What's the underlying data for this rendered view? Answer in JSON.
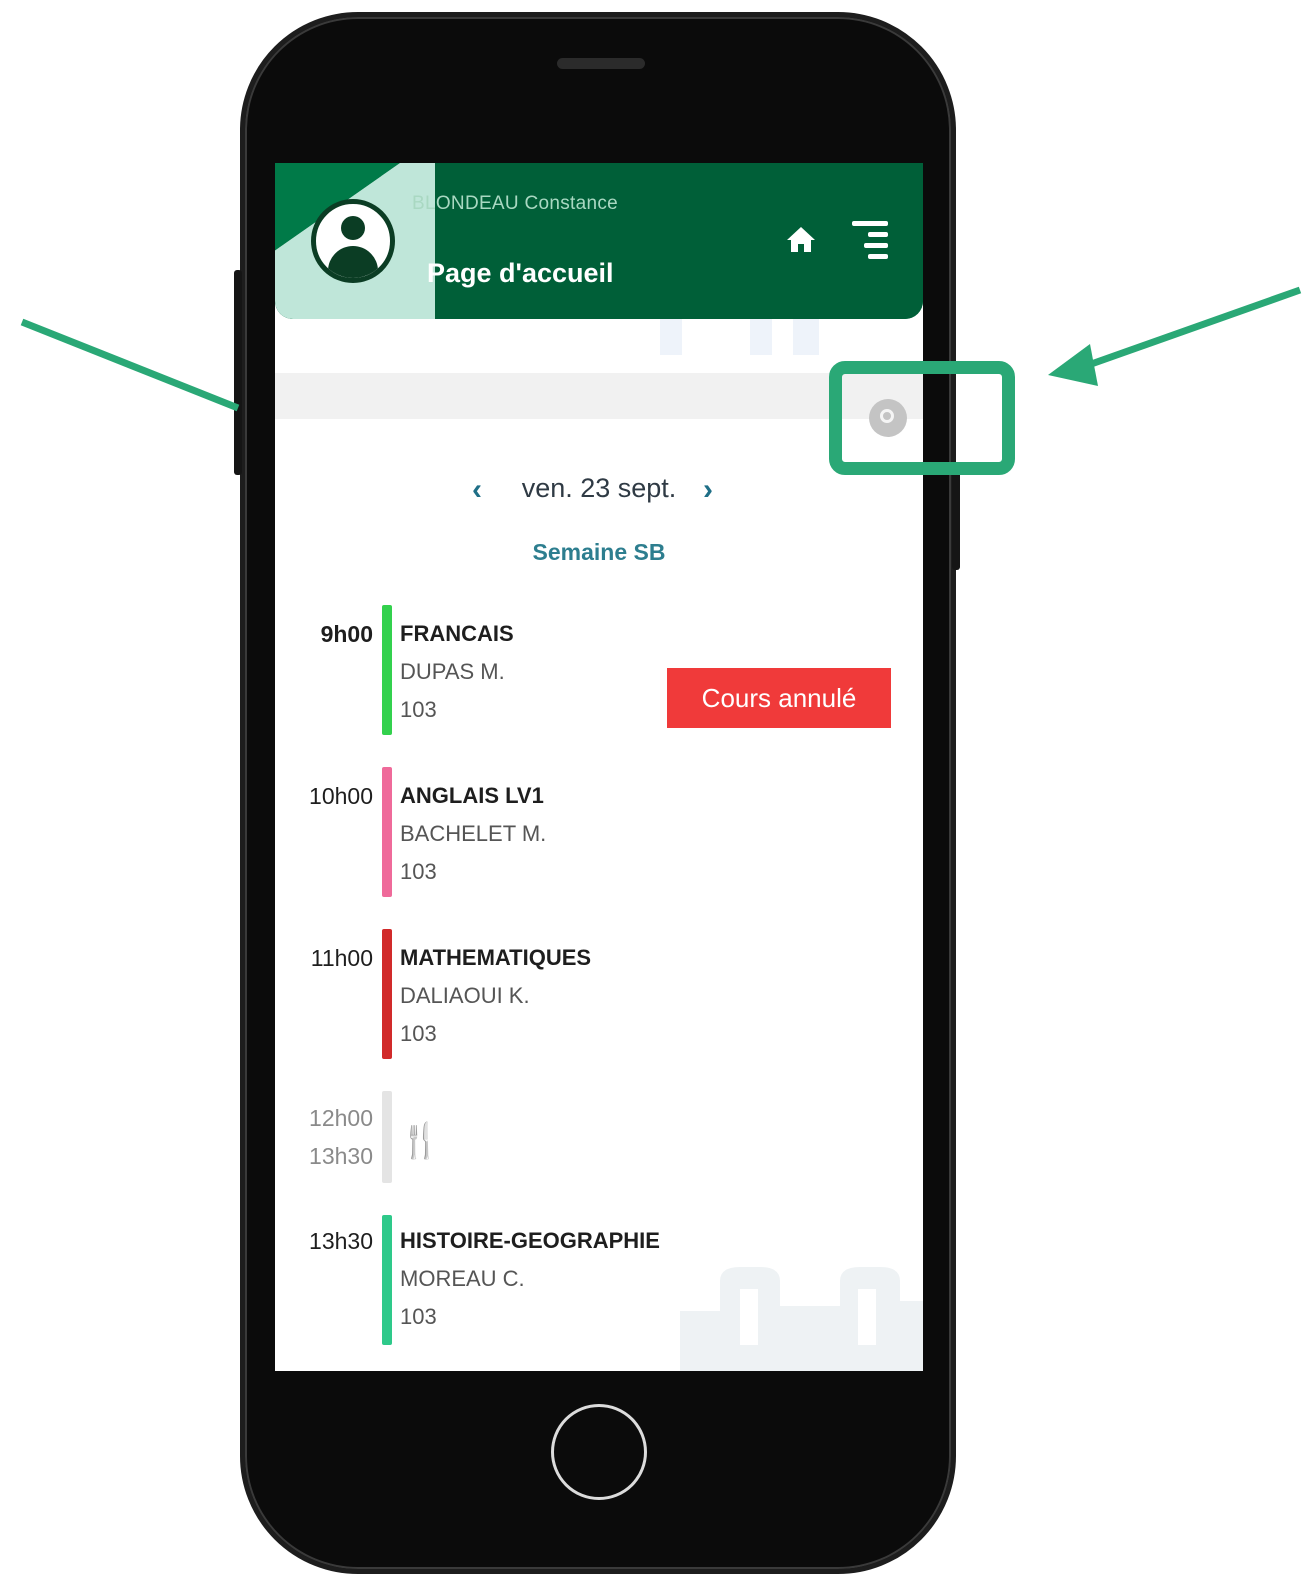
{
  "header": {
    "user_name": "BLONDEAU Constance",
    "page_title": "Page d'accueil"
  },
  "icons": {
    "home": "home-icon",
    "menu": "menu-icon",
    "edit": "edit-icon",
    "avatar": "user-avatar-icon",
    "lunch": "fork-knife-icon"
  },
  "date_nav": {
    "prev": "‹",
    "date": "ven. 23 sept.",
    "next": "›",
    "week": "Semaine SB"
  },
  "lessons": [
    {
      "time": "9h00",
      "subject": "FRANCAIS",
      "teacher": "DUPAS M.",
      "room": "103",
      "color": "#33d14d",
      "status": "Cours annulé"
    },
    {
      "time": "10h00",
      "subject": "ANGLAIS LV1",
      "teacher": "BACHELET M.",
      "room": "103",
      "color": "#ef6a9a"
    },
    {
      "time": "11h00",
      "subject": "MATHEMATIQUES",
      "teacher": "DALIAOUI K.",
      "room": "103",
      "color": "#d12a2a"
    },
    {
      "time": "12h00",
      "time_end": "13h30",
      "subject": "",
      "color": "#e4e4e4"
    },
    {
      "time": "13h30",
      "subject": "HISTOIRE-GEOGRAPHIE",
      "teacher": "MOREAU C.",
      "room": "103",
      "color": "#2ec98a"
    }
  ],
  "colors": {
    "header": "#006c40",
    "accent": "#2aa876",
    "cancel": "#f03a3a",
    "week": "#2d7e8f"
  }
}
